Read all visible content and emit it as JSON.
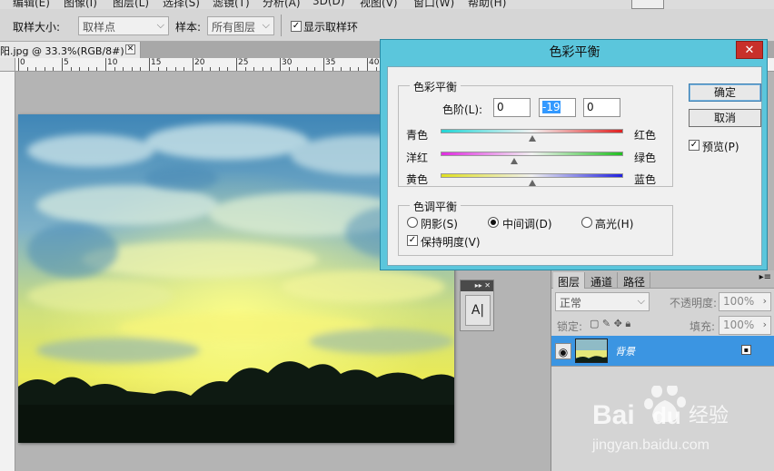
{
  "menubar": {
    "items": [
      "编辑(E)",
      "图像(I)",
      "图层(L)",
      "选择(S)",
      "滤镜(T)",
      "分析(A)",
      "3D(D)",
      "视图(V)",
      "窗口(W)",
      "帮助(H)"
    ]
  },
  "options": {
    "sample_size_label": "取样大小:",
    "sample_size_value": "取样点",
    "sample_label": "样本:",
    "sample_value": "所有图层",
    "show_ring_label": "显示取样环",
    "show_ring_checked": true
  },
  "document": {
    "tab_title": "阳.jpg @ 33.3%(RGB/8#)",
    "ruler_numbers": [
      "0",
      "5",
      "10",
      "15",
      "20",
      "25",
      "30",
      "35",
      "40"
    ]
  },
  "dialog": {
    "title": "色彩平衡",
    "color_balance": {
      "legend": "色彩平衡",
      "levels_label": "色阶(L):",
      "levels": [
        "0",
        "-19",
        "0"
      ],
      "sliders": [
        {
          "left": "青色",
          "right": "红色",
          "position": 0.5
        },
        {
          "left": "洋红",
          "right": "绿色",
          "position": 0.405
        },
        {
          "left": "黄色",
          "right": "蓝色",
          "position": 0.5
        }
      ]
    },
    "tone_balance": {
      "legend": "色调平衡",
      "shadows": "阴影(S)",
      "midtones": "中间调(D)",
      "highlights": "高光(H)",
      "selected": "midtones",
      "preserve_luminosity": "保持明度(V)",
      "preserve_checked": true
    },
    "buttons": {
      "ok": "确定",
      "cancel": "取消",
      "preview": "预览(P)",
      "preview_checked": true
    }
  },
  "layers_panel": {
    "tabs": [
      "图层",
      "通道",
      "路径"
    ],
    "blend_mode": "正常",
    "opacity_label": "不透明度:",
    "opacity": "100%",
    "lock_label": "锁定:",
    "fill_label": "填充:",
    "fill": "100%",
    "layer_name": "背景"
  },
  "mini_panel": {
    "button_glyph": "A|"
  },
  "watermark": {
    "brand": "Bai",
    "brand_suffix": "du",
    "brand_cn": "经验",
    "url": "jingyan.baidu.com"
  },
  "colors": {
    "dialog_frame": "#5bc6dc",
    "close_button": "#c8302a",
    "layer_selected": "#3b95e2"
  }
}
